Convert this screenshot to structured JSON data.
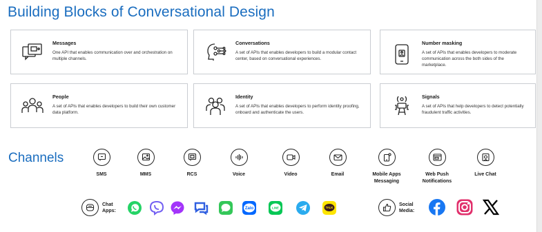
{
  "title": "Building Blocks of Conversational Design",
  "cards": [
    {
      "heading": "Messages",
      "desc": "One API that enables communication over and orchestration on multiple channels.",
      "icon": "chat-window-icon"
    },
    {
      "heading": "Conversations",
      "desc": "A set of APIs that enables developers to build a modular contact center, based on conversational experiences.",
      "icon": "network-head-icon"
    },
    {
      "heading": "Number masking",
      "desc": "A set of APIs that enables developers to moderate communication across the both sides of the marketplace.",
      "icon": "phone-mask-icon"
    },
    {
      "heading": "People",
      "desc": "A set of APIs that enables developers to build their own customer data platform.",
      "icon": "people-group-icon"
    },
    {
      "heading": "Identity",
      "desc": "A set of APIs that enables developers to perform identity proofing, onboard and authenticate the users.",
      "icon": "identity-group-icon"
    },
    {
      "heading": "Signals",
      "desc": "A set of APIs that help developers to detect potentially fraudulent traffic activities.",
      "icon": "signal-tower-icon"
    }
  ],
  "channels_label": "Channels",
  "channels": [
    {
      "label": "SMS",
      "icon": "sms-icon"
    },
    {
      "label": "MMS",
      "icon": "mms-icon"
    },
    {
      "label": "RCS",
      "icon": "rcs-icon"
    },
    {
      "label": "Voice",
      "icon": "voice-icon"
    },
    {
      "label": "Video",
      "icon": "video-icon"
    },
    {
      "label": "Email",
      "icon": "email-icon"
    },
    {
      "label": "Mobile Apps Messaging",
      "icon": "mobile-apps-icon"
    },
    {
      "label": "Web Push Notifications",
      "icon": "web-push-icon"
    },
    {
      "label": "Live Chat",
      "icon": "live-chat-icon"
    }
  ],
  "chat_apps_label": "Chat Apps:",
  "chat_apps": [
    {
      "name": "whatsapp-icon",
      "color": "#25D366"
    },
    {
      "name": "viber-icon",
      "color": "#7360F2"
    },
    {
      "name": "messenger-icon",
      "color": "#A334FA"
    },
    {
      "name": "generic-chat-icon",
      "color": "#2F5FE0"
    },
    {
      "name": "imessage-icon",
      "color": "#34C759"
    },
    {
      "name": "zalo-icon",
      "color": "#0068FF"
    },
    {
      "name": "line-icon",
      "color": "#06C755"
    },
    {
      "name": "telegram-icon",
      "color": "#2AABEE"
    },
    {
      "name": "kakaotalk-icon",
      "color": "#FEE500"
    }
  ],
  "chat_apps_logos": {
    "zalo": "Zalo",
    "line": "LINE",
    "kakaotalk": "TALK"
  },
  "social_label": "Social Media:",
  "social": [
    {
      "name": "facebook-icon",
      "color": "#1877F2"
    },
    {
      "name": "instagram-icon",
      "color": "#E1306C"
    },
    {
      "name": "x-icon",
      "color": "#000000"
    }
  ],
  "accent_color": "#1a6dbf"
}
